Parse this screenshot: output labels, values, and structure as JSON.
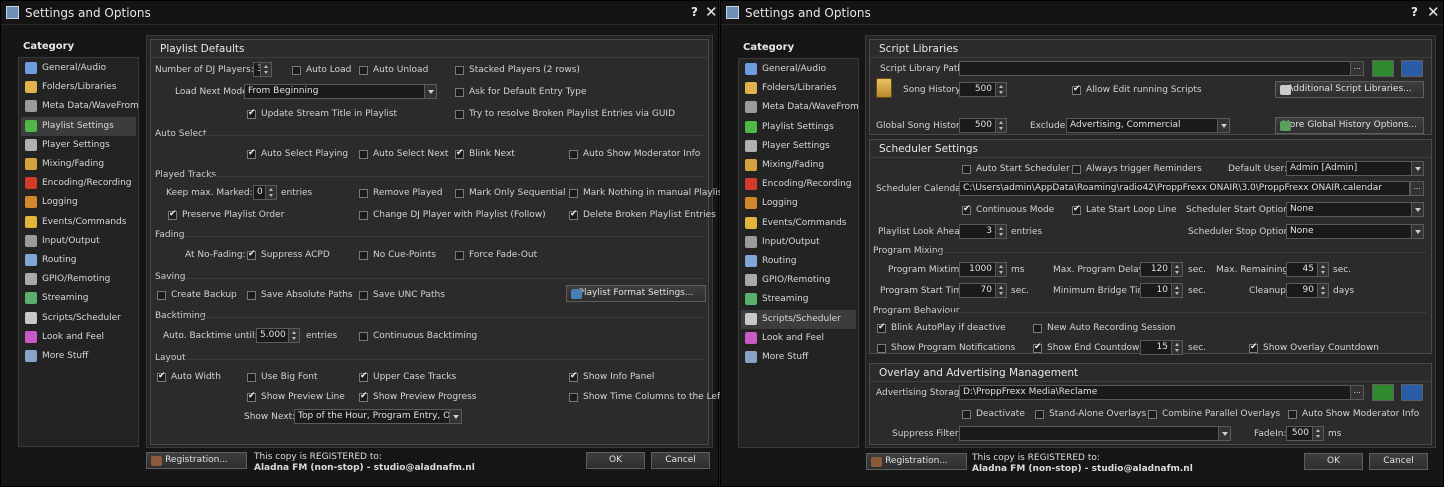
{
  "window": {
    "title": "Settings and Options",
    "help": "?",
    "close": "✕"
  },
  "category_header": "Category",
  "categories": [
    {
      "label": "General/Audio",
      "icon": "music-note-icon",
      "color": "#6f9be0"
    },
    {
      "label": "Folders/Libraries",
      "icon": "folder-icon",
      "color": "#e2b24a"
    },
    {
      "label": "Meta Data/WaveFrom",
      "icon": "waveform-icon",
      "color": "#9a9a9a"
    },
    {
      "label": "Playlist Settings",
      "icon": "playlist-icon",
      "color": "#4fb848"
    },
    {
      "label": "Player Settings",
      "icon": "player-icon",
      "color": "#b0b0b0"
    },
    {
      "label": "Mixing/Fading",
      "icon": "mixing-icon",
      "color": "#d4a33c"
    },
    {
      "label": "Encoding/Recording",
      "icon": "record-icon",
      "color": "#d23a2a"
    },
    {
      "label": "Logging",
      "icon": "log-icon",
      "color": "#d2872a"
    },
    {
      "label": "Events/Commands",
      "icon": "lightning-icon",
      "color": "#e0b53a"
    },
    {
      "label": "Input/Output",
      "icon": "io-icon",
      "color": "#9a9a9a"
    },
    {
      "label": "Routing",
      "icon": "routing-icon",
      "color": "#7fa8d6"
    },
    {
      "label": "GPIO/Remoting",
      "icon": "gpio-icon",
      "color": "#aaaaaa"
    },
    {
      "label": "Streaming",
      "icon": "streaming-icon",
      "color": "#5ab06a"
    },
    {
      "label": "Scripts/Scheduler",
      "icon": "clock-icon",
      "color": "#c8c8c8"
    },
    {
      "label": "Look and Feel",
      "icon": "palette-icon",
      "color": "#c85ac8"
    },
    {
      "label": "More Stuff",
      "icon": "more-icon",
      "color": "#8aa2c8"
    }
  ],
  "footer": {
    "registration_button": "Registration...",
    "registered_line": "This copy is REGISTERED to:",
    "registered_to": "Aladna FM (non-stop) - studio@aladnafm.nl",
    "ok": "OK",
    "cancel": "Cancel"
  },
  "playlist": {
    "group_title": "Playlist Defaults",
    "num_dj_label": "Number of DJ Players:",
    "num_dj_value": "3",
    "auto_load": "Auto Load",
    "auto_unload": "Auto Unload",
    "stacked_players": "Stacked Players (2 rows)",
    "load_next_label": "Load Next Mode:",
    "load_next_value": "From Beginning",
    "ask_default": "Ask for Default Entry Type",
    "update_stream_title": "Update Stream Title in Playlist",
    "resolve_broken": "Try to resolve Broken Playlist Entries via GUID",
    "auto_select_title": "Auto Select",
    "auto_select_playing": "Auto Select Playing",
    "auto_select_next": "Auto Select Next",
    "blink_next": "Blink Next",
    "auto_show_moderator": "Auto Show Moderator Info",
    "played_tracks_title": "Played Tracks",
    "keep_marked_label": "Keep max. Marked:",
    "keep_marked_value": "0",
    "entries": "entries",
    "remove_played": "Remove Played",
    "mark_only_sequential": "Mark Only Sequential",
    "mark_nothing_manual": "Mark Nothing in manual Playlists",
    "preserve_order": "Preserve Playlist Order",
    "change_dj_player": "Change DJ Player with Playlist (Follow)",
    "delete_broken": "Delete Broken Playlist Entries",
    "fading_title": "Fading",
    "at_no_fading": "At No-Fading:",
    "suppress_acpd": "Suppress ACPD",
    "no_cue_points": "No Cue-Points",
    "force_fade_out": "Force Fade-Out",
    "saving_title": "Saving",
    "create_backup": "Create Backup",
    "save_absolute": "Save Absolute Paths",
    "save_unc": "Save UNC Paths",
    "format_settings": "Playlist Format Settings...",
    "backtiming_title": "Backtiming",
    "auto_backtime_label": "Auto. Backtime until:",
    "auto_backtime_value": "5.000",
    "continuous_backtiming": "Continuous Backtiming",
    "layout_title": "Layout",
    "auto_width": "Auto Width",
    "use_big_font": "Use Big Font",
    "upper_case": "Upper Case Tracks",
    "show_info_panel": "Show Info Panel",
    "show_preview_line": "Show Preview Line",
    "show_preview_progress": "Show Preview Progress",
    "show_time_columns": "Show Time Columns to the Left",
    "show_next_label": "Show Next:",
    "show_next_value": "Top of the Hour, Program Entry, Ov..."
  },
  "scripts": {
    "libraries_title": "Script Libraries",
    "library_path_label": "Script Library Path:",
    "library_path_value": "",
    "song_history_label": "Song History:",
    "song_history_value": "500",
    "allow_edit": "Allow Edit running Scripts",
    "additional_libraries": "Additional Script Libraries...",
    "global_history_label": "Global Song History:",
    "global_history_value": "500",
    "exclude_label": "Exclude:",
    "exclude_value": "Advertising, Commercial",
    "more_history": "More Global History Options...",
    "scheduler_title": "Scheduler Settings",
    "auto_start": "Auto Start Scheduler",
    "always_trigger": "Always trigger Reminders",
    "default_user_label": "Default User:",
    "default_user_value": "Admin [Admin]",
    "calendar_label": "Scheduler Calendar:",
    "calendar_value": "C:\\Users\\admin\\AppData\\Roaming\\radio42\\ProppFrexx ONAIR\\3.0\\ProppFrexx ONAIR.calendar",
    "continuous_mode": "Continuous Mode",
    "late_start_loop": "Late Start Loop Line",
    "start_options_label": "Scheduler Start Options:",
    "start_options_value": "None",
    "look_ahead_label": "Playlist Look Ahead:",
    "look_ahead_value": "3",
    "entries": "entries",
    "stop_options_label": "Scheduler Stop Options:",
    "stop_options_value": "None",
    "program_mixing_title": "Program Mixing",
    "mixtime_label": "Program Mixtime:",
    "mixtime_value": "1000",
    "ms": "ms",
    "max_delay_label": "Max. Program Delay:",
    "max_delay_value": "120",
    "sec": "sec.",
    "max_remaining_label": "Max. Remaining:",
    "max_remaining_value": "45",
    "start_time_label": "Program Start Time:",
    "start_time_value": "70",
    "min_bridge_label": "Minimum Bridge Time:",
    "min_bridge_value": "10",
    "cleanup_label": "Cleanup:",
    "cleanup_value": "90",
    "days": "days",
    "program_behaviour_title": "Program Behaviour",
    "blink_autoplay": "Blink AutoPlay if deactive",
    "new_auto_recording": "New Auto Recording Session",
    "show_notifications": "Show Program Notifications",
    "show_end_countdown": "Show End Countdown",
    "end_countdown_value": "15",
    "show_overlay_countdown": "Show Overlay Countdown",
    "overlay_title": "Overlay and Advertising Management",
    "ad_storage_label": "Advertising Storage:",
    "ad_storage_value": "D:\\ProppFrexx Media\\Reclame",
    "deactivate": "Deactivate",
    "standalone_overlays": "Stand-Alone Overlays",
    "combine_parallel": "Combine Parallel Overlays",
    "auto_show_moderator": "Auto Show Moderator Info",
    "suppress_filter_label": "Suppress Filter:",
    "suppress_filter_value": "",
    "fadein_label": "FadeIn:",
    "fadein_value": "500",
    "ms2": "ms"
  },
  "colors": {
    "accent_green": "#2f8a2f",
    "accent_blue": "#2a5caa"
  }
}
